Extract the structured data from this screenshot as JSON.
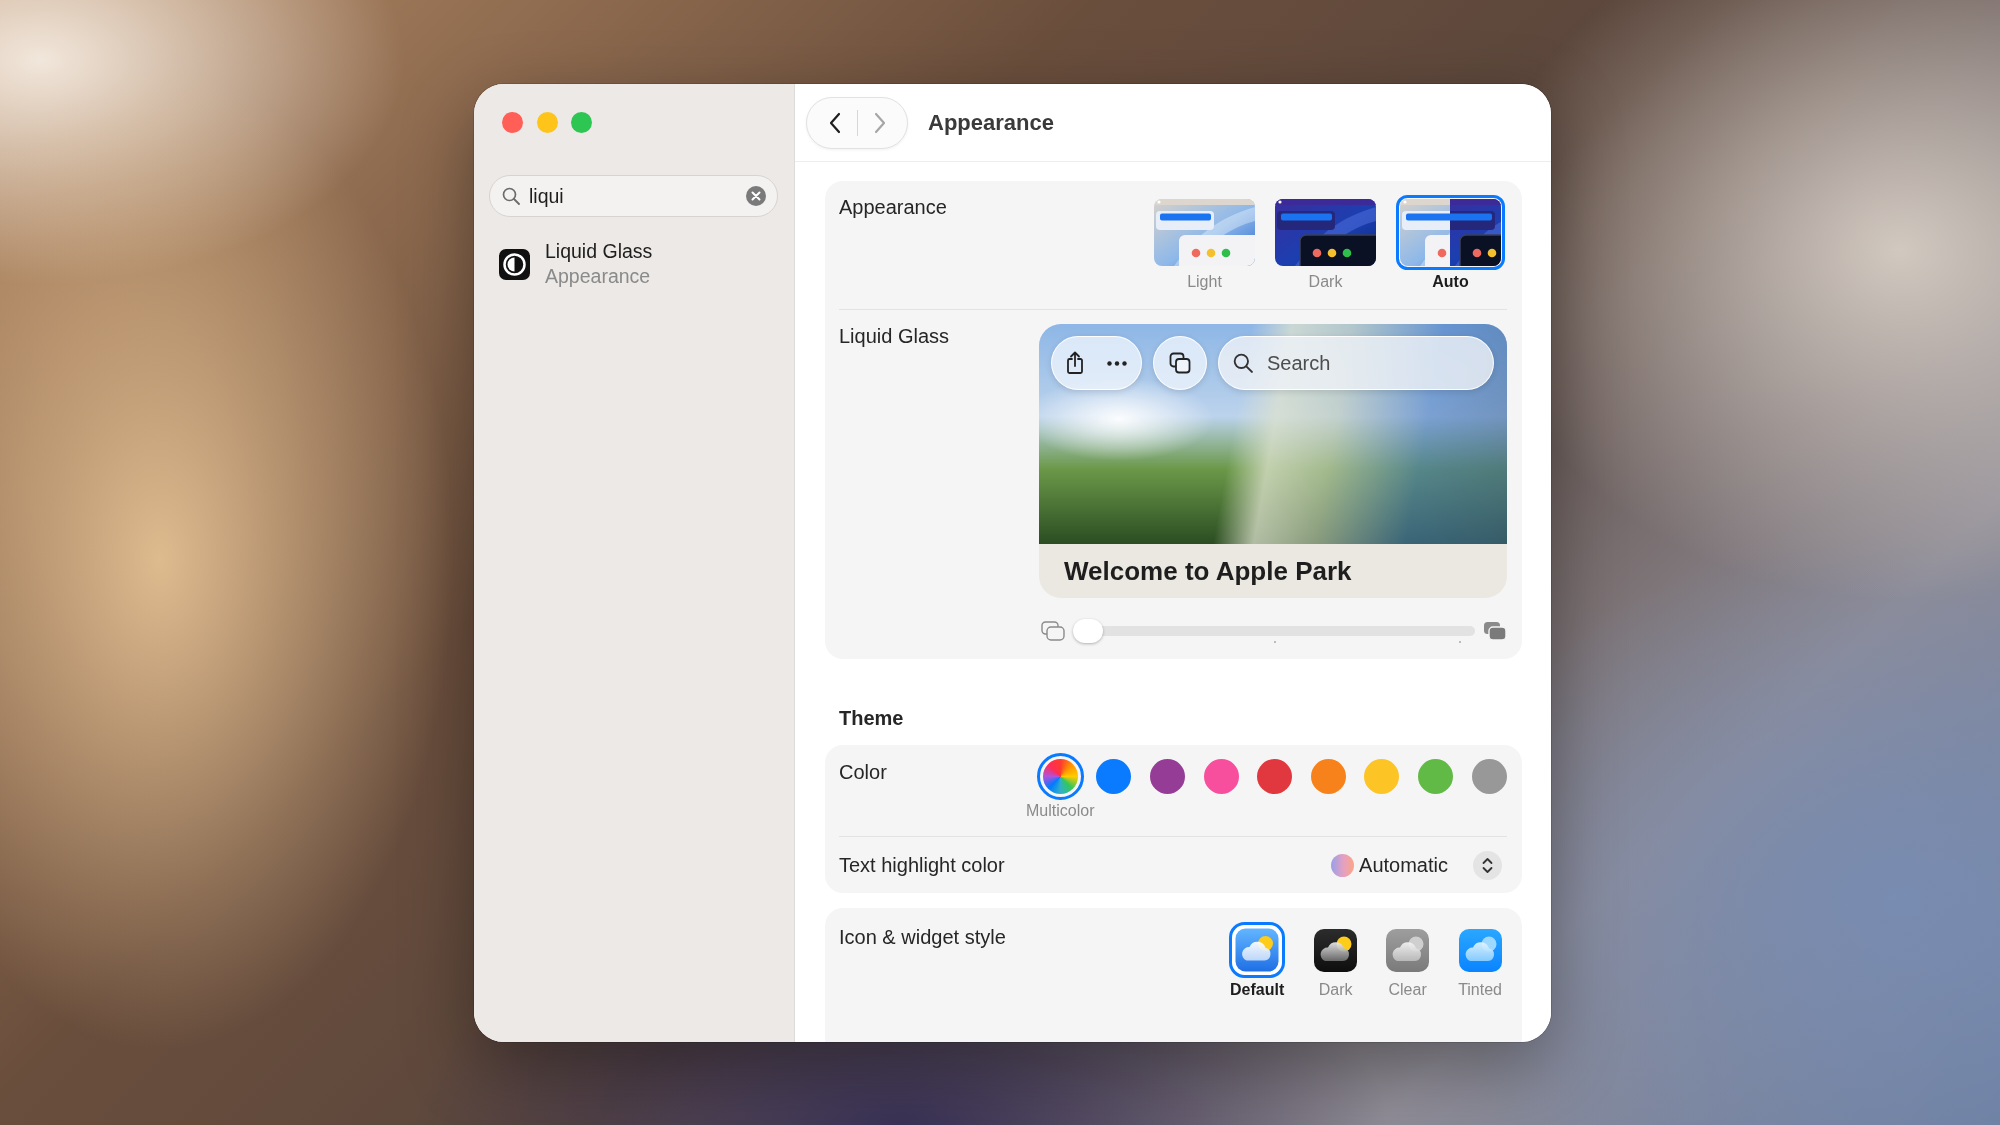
{
  "window": {
    "traffic_lights": [
      {
        "color": "#ff5f57"
      },
      {
        "color": "#fec41a"
      },
      {
        "color": "#2dc653"
      }
    ]
  },
  "sidebar": {
    "search": {
      "value": "liqui"
    },
    "results": [
      {
        "title": "Liquid Glass",
        "subtitle": "Appearance",
        "selected": false
      }
    ]
  },
  "toolbar": {
    "back": {
      "disabled": false
    },
    "forward": {
      "disabled": true
    },
    "title": "Appearance"
  },
  "appearance": {
    "label": "Appearance",
    "options": [
      {
        "kind": "light",
        "label": "Light",
        "selected": false
      },
      {
        "kind": "dark",
        "label": "Dark",
        "selected": false
      },
      {
        "kind": "auto",
        "label": "Auto",
        "selected": true
      }
    ]
  },
  "liquid_glass": {
    "label": "Liquid Glass",
    "preview": {
      "search": {
        "placeholder": "Search"
      },
      "heading": "Welcome to Apple Park"
    },
    "slider": {
      "level": 0
    }
  },
  "theme": {
    "heading": "Theme",
    "color": {
      "label": "Color",
      "swatches": [
        {
          "kind": "multicolor",
          "label": "Multicolor",
          "selected": true
        },
        {
          "kind": "solid",
          "color": "#0a7aff",
          "selected": false
        },
        {
          "kind": "solid",
          "color": "#953d96",
          "selected": false
        },
        {
          "kind": "solid",
          "color": "#f74f9e",
          "selected": false
        },
        {
          "kind": "solid",
          "color": "#e0383e",
          "selected": false
        },
        {
          "kind": "solid",
          "color": "#f7821b",
          "selected": false
        },
        {
          "kind": "solid",
          "color": "#fdc426",
          "selected": false
        },
        {
          "kind": "solid",
          "color": "#62ba46",
          "selected": false
        },
        {
          "kind": "solid",
          "color": "#989898",
          "selected": false
        }
      ]
    },
    "highlight": {
      "label": "Text highlight color",
      "value": "Automatic"
    }
  },
  "icon_widget_style": {
    "label": "Icon & widget style",
    "options": [
      {
        "kind": "default",
        "label": "Default",
        "selected": true
      },
      {
        "kind": "dark",
        "label": "Dark",
        "selected": false
      },
      {
        "kind": "clear",
        "label": "Clear",
        "selected": false
      },
      {
        "kind": "tinted",
        "label": "Tinted",
        "selected": false
      }
    ]
  }
}
